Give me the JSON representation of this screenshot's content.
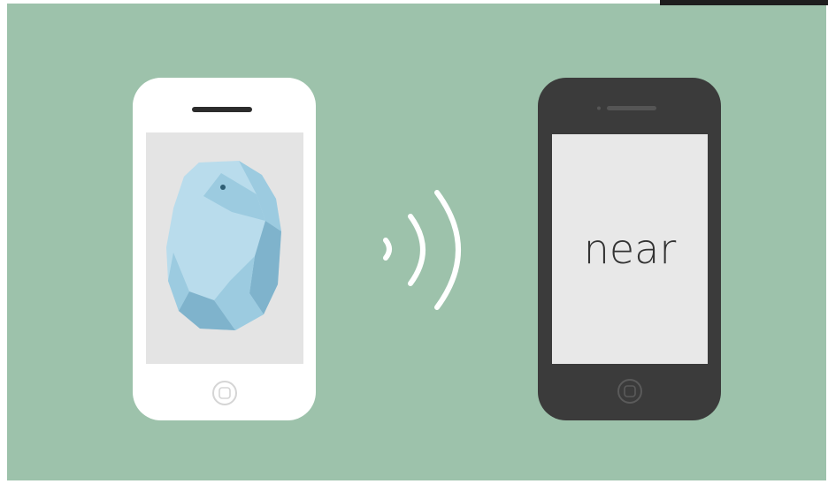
{
  "colors": {
    "background": "#9dc2ab",
    "white_phone_body": "#ffffff",
    "white_phone_screen": "#e4e4e4",
    "black_phone_body": "#3b3b3b",
    "black_phone_screen": "#e8e8e8",
    "beacon_light": "#b9dcec",
    "beacon_mid": "#9ccbe0",
    "beacon_dark": "#7fb3cc",
    "signal_waves": "#ffffff",
    "near_text": "#333333"
  },
  "icons": {
    "beacon": "estimote-beacon-icon",
    "signal": "wireless-signal-icon",
    "home_button": "home-button-icon"
  },
  "black_phone": {
    "screen_text": "near"
  }
}
